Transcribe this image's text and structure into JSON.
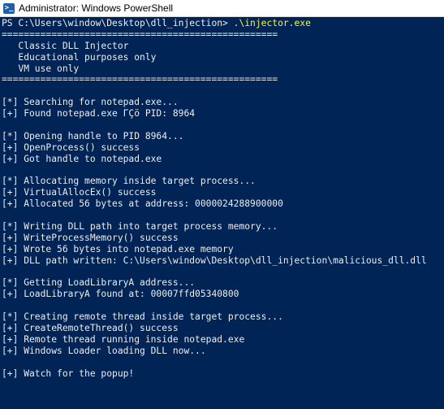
{
  "window": {
    "title": "Administrator: Windows PowerShell",
    "icon": "powershell-icon"
  },
  "colors": {
    "console_background": "#012456",
    "console_text": "#ededed",
    "command_text": "#f5f542"
  },
  "prompt": {
    "path": "PS C:\\Users\\window\\Desktop\\dll_injection> ",
    "command": ".\\injector.exe"
  },
  "output_lines": [
    "==================================================",
    "   Classic DLL Injector",
    "   Educational purposes only",
    "   VM use only",
    "==================================================",
    "",
    "[*] Searching for notepad.exe...",
    "[+] Found notepad.exe ΓÇö PID: 8964",
    "",
    "[*] Opening handle to PID 8964...",
    "[+] OpenProcess() success",
    "[+] Got handle to notepad.exe",
    "",
    "[*] Allocating memory inside target process...",
    "[+] VirtualAllocEx() success",
    "[+] Allocated 56 bytes at address: 0000024288900000",
    "",
    "[*] Writing DLL path into target process memory...",
    "[+] WriteProcessMemory() success",
    "[+] Wrote 56 bytes into notepad.exe memory",
    "[+] DLL path written: C:\\Users\\window\\Desktop\\dll_injection\\malicious_dll.dll",
    "",
    "[*] Getting LoadLibraryA address...",
    "[+] LoadLibraryA found at: 00007ffd05340800",
    "",
    "[*] Creating remote thread inside target process...",
    "[+] CreateRemoteThread() success",
    "[+] Remote thread running inside notepad.exe",
    "[+] Windows Loader loading DLL now...",
    "",
    "[+] Watch for the popup!"
  ]
}
